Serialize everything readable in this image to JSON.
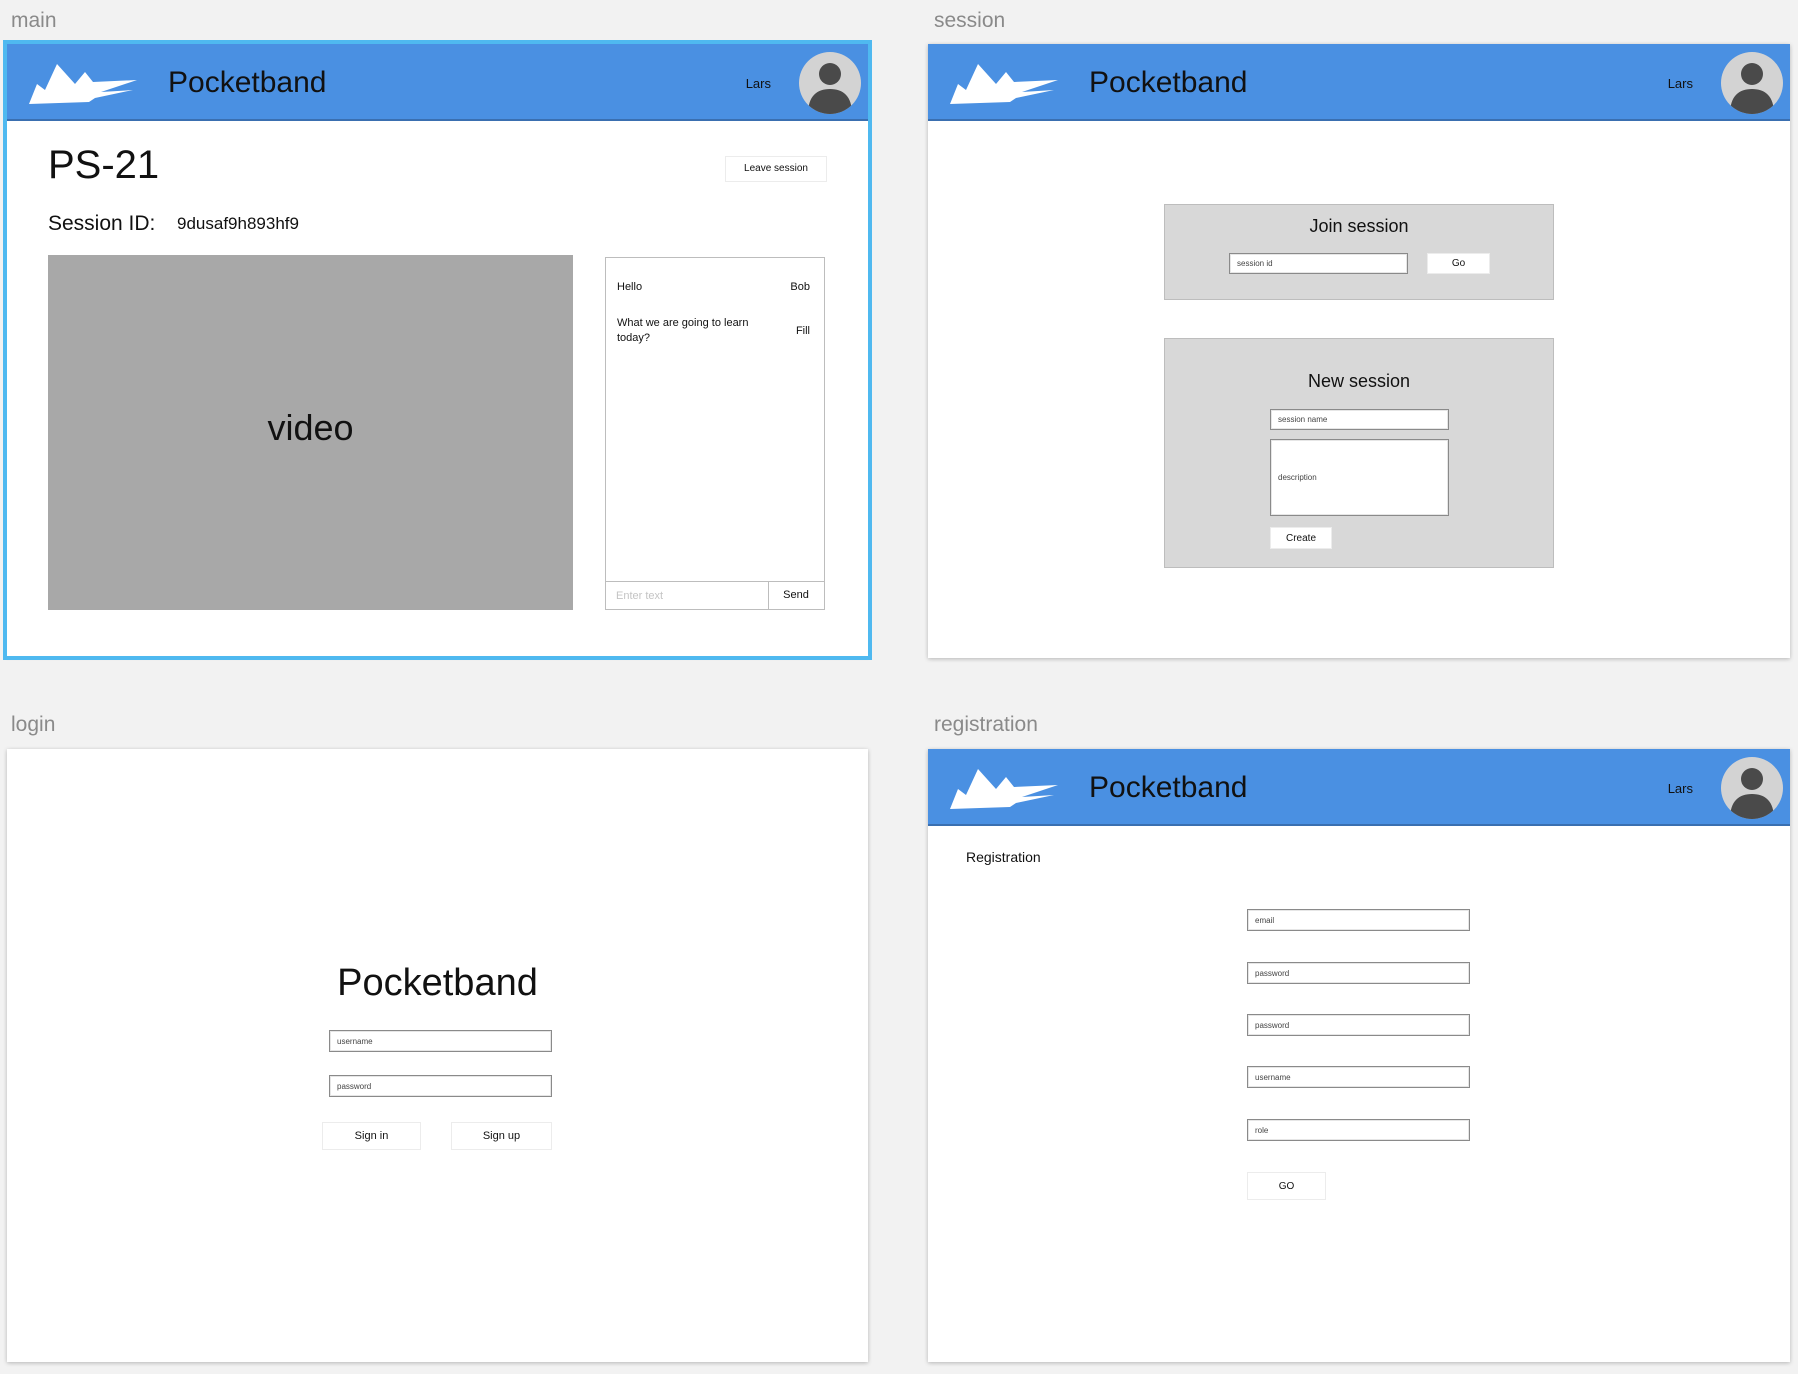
{
  "artboards": {
    "main": {
      "label": "main"
    },
    "session": {
      "label": "session"
    },
    "login": {
      "label": "login"
    },
    "registration": {
      "label": "registration"
    }
  },
  "header": {
    "app_title": "Pocketband",
    "user_name": "Lars"
  },
  "main_screen": {
    "title": "PS-21",
    "leave_button": "Leave session",
    "session_id_label": "Session ID:",
    "session_id_value": "9dusaf9h893hf9",
    "video_label": "video",
    "chat": {
      "messages": [
        {
          "text": "Hello",
          "author": "Bob"
        },
        {
          "text": "What we are going to learn today?",
          "author": "Fill"
        }
      ],
      "input_placeholder": "Enter text",
      "send_label": "Send"
    }
  },
  "session_screen": {
    "join": {
      "title": "Join session",
      "input_placeholder": "session id",
      "go_label": "Go"
    },
    "new": {
      "title": "New session",
      "name_placeholder": "session name",
      "description_placeholder": "description",
      "create_label": "Create"
    }
  },
  "login_screen": {
    "title": "Pocketband",
    "username_placeholder": "username",
    "password_placeholder": "password",
    "sign_in_label": "Sign in",
    "sign_up_label": "Sign up"
  },
  "registration_screen": {
    "heading": "Registration",
    "fields": [
      "email",
      "password",
      "password",
      "username",
      "role"
    ],
    "go_label": "GO"
  },
  "colors": {
    "header_blue": "#4a90e2",
    "selection": "#4fb9f0",
    "panel_gray": "#d8d8d8",
    "video_gray": "#a8a8a8"
  }
}
